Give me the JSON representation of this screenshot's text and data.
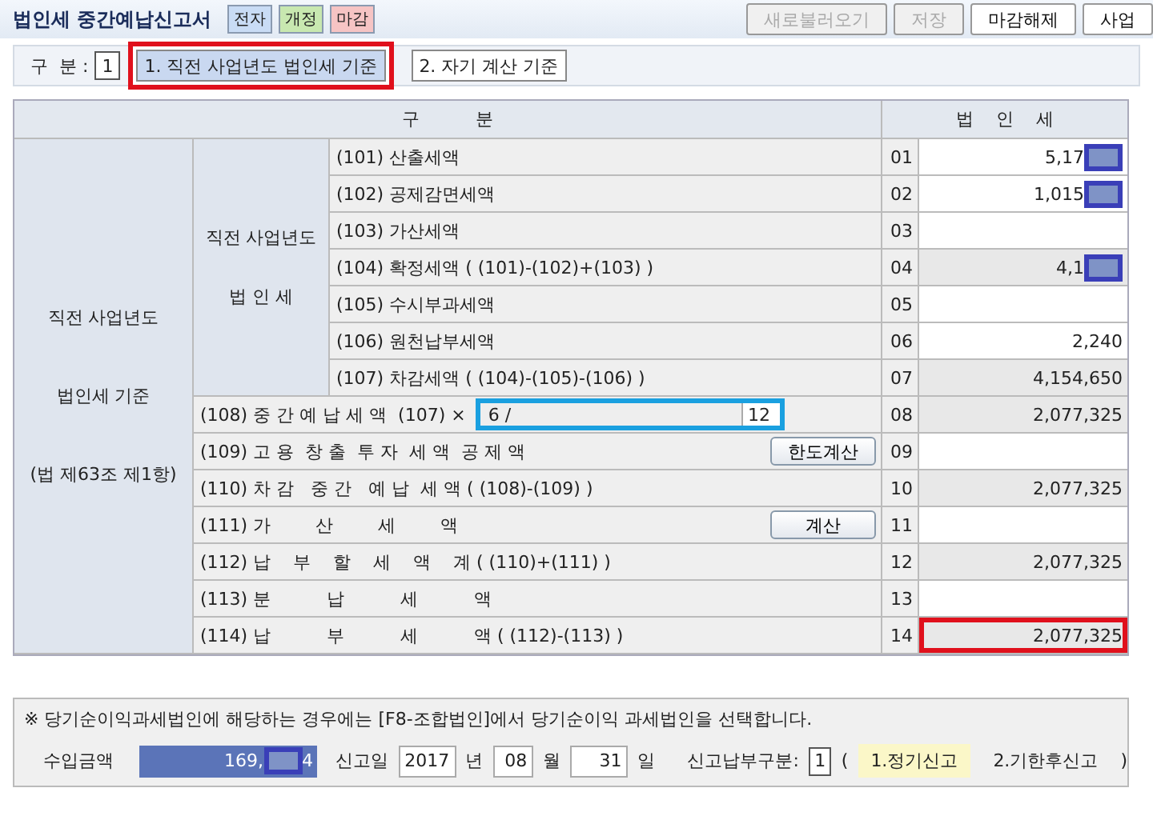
{
  "header": {
    "title": "법인세 중간예납신고서",
    "badges": [
      {
        "label": "전자",
        "color": "#c9dcf5"
      },
      {
        "label": "개정",
        "color": "#c8e8b0"
      },
      {
        "label": "마감",
        "color": "#f6c4c4"
      }
    ],
    "buttons": [
      {
        "label": "새로불러오기",
        "disabled": true
      },
      {
        "label": "저장",
        "disabled": true
      },
      {
        "label": "마감해제",
        "disabled": false
      },
      {
        "label": "사업",
        "disabled": false
      }
    ]
  },
  "division": {
    "label": "구  분 :",
    "code": "1",
    "options": [
      {
        "label": "1. 직전 사업년도 법인세 기준",
        "selected": true,
        "highlighted": true
      },
      {
        "label": "2. 자기 계산 기준",
        "selected": false,
        "highlighted": false
      }
    ]
  },
  "table": {
    "columns": [
      "구          분",
      "법    인    세"
    ],
    "group": [
      "직전 사업년도",
      "법인세 기준",
      "(법 제63조 제1항)"
    ],
    "subgroup": [
      "직전 사업년도",
      "법 인 세"
    ],
    "rows": [
      {
        "label": "(101) 산출세액",
        "code": "01",
        "value": "5,17",
        "editable": true,
        "redacted": true,
        "highlighted": false
      },
      {
        "label": "(102) 공제감면세액",
        "code": "02",
        "value": "1,015",
        "editable": true,
        "redacted": true,
        "highlighted": false
      },
      {
        "label": "(103) 가산세액",
        "code": "03",
        "value": "",
        "editable": true,
        "highlighted": false
      },
      {
        "label": "(104) 확정세액 ( (101)-(102)+(103) )",
        "code": "04",
        "value": "4,1",
        "editable": false,
        "redacted": true,
        "highlighted": false
      },
      {
        "label": "(105) 수시부과세액",
        "code": "05",
        "value": "",
        "editable": true,
        "highlighted": false
      },
      {
        "label": "(106) 원천납부세액",
        "code": "06",
        "value": "2,240",
        "editable": true,
        "highlighted": false
      },
      {
        "label": "(107) 차감세액 ( (104)-(105)-(106) )",
        "code": "07",
        "value": "4,154,650",
        "editable": false,
        "highlighted": false
      },
      {
        "label": "(108) 중 간 예 납 세 액  (107) ×",
        "code": "08",
        "value": "2,077,325",
        "editable": false,
        "highlighted": false,
        "wide": true,
        "ratio": {
          "numerator": "6 /",
          "denominator": "12",
          "highlighted": true
        }
      },
      {
        "label": "(109) 고 용  창 출  투 자  세 액  공 제 액",
        "code": "09",
        "value": "",
        "editable": true,
        "highlighted": false,
        "wide": true,
        "action": "한도계산"
      },
      {
        "label": "(110) 차 감   중 간   예 납  세 액 ( (108)-(109) )",
        "code": "10",
        "value": "2,077,325",
        "editable": false,
        "highlighted": false,
        "wide": true
      },
      {
        "label": "(111) 가        산        세        액",
        "code": "11",
        "value": "",
        "editable": true,
        "highlighted": false,
        "wide": true,
        "action": "계산"
      },
      {
        "label": "(112) 납    부    할    세    액    계 ( (110)+(111) )",
        "code": "12",
        "value": "2,077,325",
        "editable": false,
        "highlighted": false,
        "wide": true
      },
      {
        "label": "(113) 분          납          세          액",
        "code": "13",
        "value": "",
        "editable": true,
        "highlighted": false,
        "wide": true
      },
      {
        "label": "(114) 납          부          세          액 ( (112)-(113) )",
        "code": "14",
        "value": "2,077,325",
        "editable": false,
        "highlighted": true,
        "wide": true
      }
    ]
  },
  "footer": {
    "note": "※ 당기순이익과세법인에 해당하는 경우에는 [F8-조합법인]에서 당기순이익 과세법인을 선택합니다.",
    "revenue": {
      "label": "수입금액",
      "value_start": "169,",
      "value_end": "4",
      "redacted": true
    },
    "report_date": {
      "label": "신고일",
      "year": "2017",
      "year_unit": "년",
      "month": "08",
      "month_unit": "월",
      "day": "31",
      "day_unit": "일"
    },
    "payment_type": {
      "label": "신고납부구분:",
      "code": "1",
      "open": "(",
      "close": ")",
      "options": [
        {
          "label": "1.정기신고",
          "selected": true
        },
        {
          "label": "2.기한후신고",
          "selected": false
        }
      ]
    }
  }
}
